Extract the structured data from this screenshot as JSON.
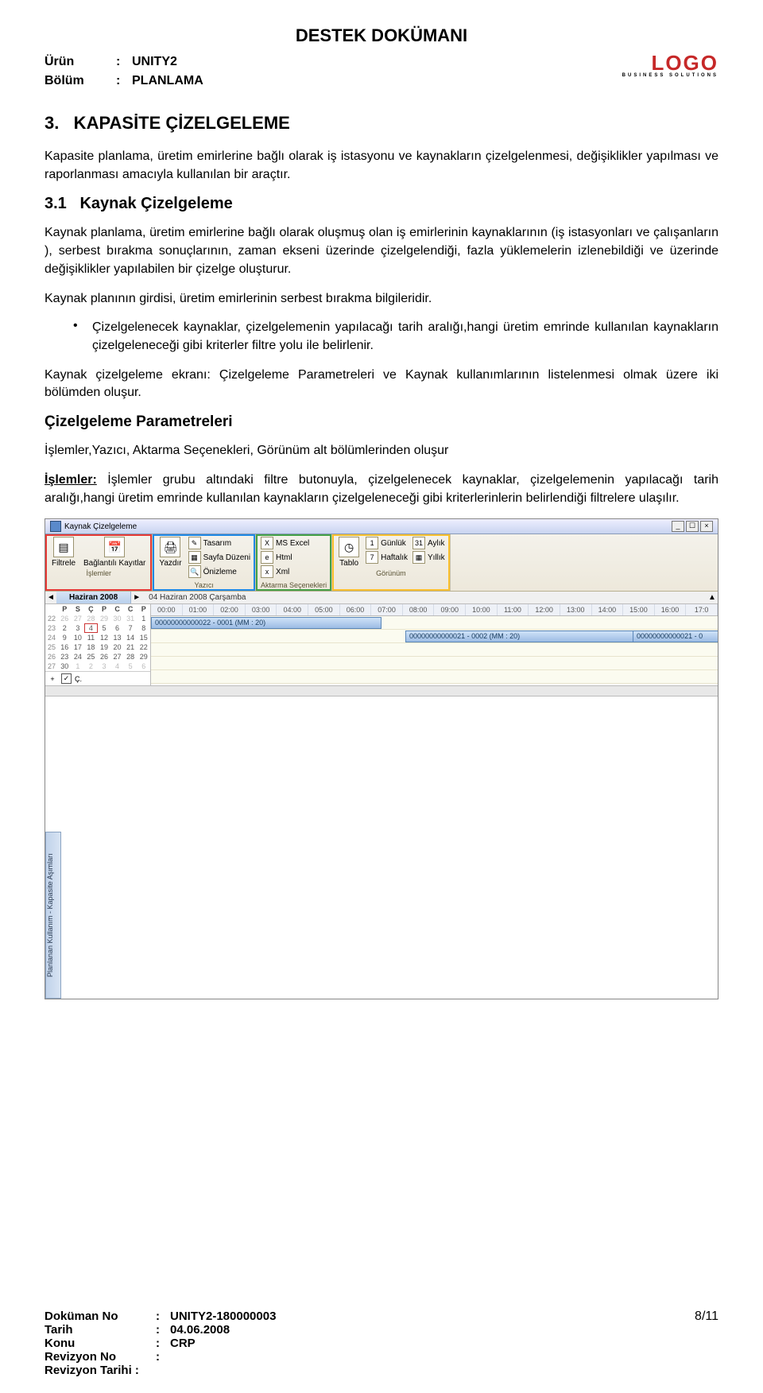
{
  "doc_title": "DESTEK DOKÜMANI",
  "header": {
    "urun_label": "Ürün",
    "bolum_label": "Bölüm",
    "urun_value": "UNITY2",
    "bolum_value": "PLANLAMA"
  },
  "logo": {
    "main": "LOGO",
    "sub": "BUSINESS SOLUTIONS"
  },
  "section": {
    "num_title": "3.   KAPASİTE ÇİZELGELEME",
    "para1": "Kapasite planlama, üretim emirlerine bağlı olarak iş istasyonu ve kaynakların çizelgelenmesi, değişiklikler yapılması ve raporlanması amacıyla kullanılan bir araçtır."
  },
  "subsection": {
    "num_title": "3.1   Kaynak Çizelgeleme",
    "para2": "Kaynak planlama, üretim emirlerine bağlı olarak oluşmuş olan iş emirlerinin kaynaklarının (iş istasyonları ve çalışanların ), serbest bırakma sonuçlarının, zaman ekseni üzerinde çizelgelendiği, fazla yüklemelerin izlenebildiği ve üzerinde değişiklikler yapılabilen bir çizelge oluşturur.",
    "para3": "Kaynak planının girdisi, üretim emirlerinin serbest bırakma bilgileridir.",
    "bullet1": "Çizelgelenecek kaynaklar, çizelgelemenin yapılacağı tarih aralığı,hangi üretim emrinde kullanılan kaynakların çizelgeleneceği gibi kriterler filtre yolu ile belirlenir.",
    "para4": "Kaynak çizelgeleme ekranı: Çizelgeleme Parametreleri ve Kaynak kullanımlarının listelenmesi olmak üzere iki bölümden oluşur.",
    "subhead": "Çizelgeleme Parametreleri",
    "para5": "İşlemler,Yazıcı, Aktarma Seçenekleri, Görünüm alt bölümlerinden oluşur",
    "islemler_label": "İşlemler:",
    "para6_rest": " İşlemler grubu altındaki filtre butonuyla, çizelgelenecek kaynaklar, çizelgelemenin yapılacağı tarih aralığı,hangi üretim emrinde kullanılan kaynakların çizelgeleneceği gibi kriterlerinlerin belirlendiği filtrelere ulaşılır."
  },
  "screenshot": {
    "title": "Kaynak Çizelgeleme",
    "ribbon": {
      "islemler": {
        "filtrele": "Filtrele",
        "baglantili": "Bağlantılı Kayıtlar",
        "label": "İşlemler"
      },
      "yazici": {
        "yazdir": "Yazdır",
        "tasarim": "Tasarım",
        "sayfa": "Sayfa Düzeni",
        "onizleme": "Önizleme",
        "label": "Yazıcı"
      },
      "aktarma": {
        "excel": "MS Excel",
        "html": "Html",
        "xml": "Xml",
        "label": "Aktarma Seçenekleri"
      },
      "gorunum": {
        "tablo": "Tablo",
        "gunluk": "Günlük",
        "aylik": "Aylık",
        "haftalik": "Haftalık",
        "yillik": "Yıllık",
        "g1": "1",
        "g31": "31",
        "g7": "7",
        "label": "Görünüm"
      }
    },
    "nav": {
      "month": "Haziran 2008",
      "day": "04 Haziran 2008 Çarşamba"
    },
    "calendar": {
      "headers": [
        "",
        "P",
        "S",
        "Ç",
        "P",
        "C",
        "C",
        "P"
      ],
      "rows": [
        [
          "22",
          "26",
          "27",
          "28",
          "29",
          "30",
          "31",
          "1"
        ],
        [
          "23",
          "2",
          "3",
          "4",
          "5",
          "6",
          "7",
          "8"
        ],
        [
          "24",
          "9",
          "10",
          "11",
          "12",
          "13",
          "14",
          "15"
        ],
        [
          "25",
          "16",
          "17",
          "18",
          "19",
          "20",
          "21",
          "22"
        ],
        [
          "26",
          "23",
          "24",
          "25",
          "26",
          "27",
          "28",
          "29"
        ],
        [
          "27",
          "30",
          "1",
          "2",
          "3",
          "4",
          "5",
          "6"
        ]
      ],
      "footer_label": "Ç."
    },
    "timeline": {
      "hours": [
        "00:00",
        "01:00",
        "02:00",
        "03:00",
        "04:00",
        "05:00",
        "06:00",
        "07:00",
        "08:00",
        "09:00",
        "10:00",
        "11:00",
        "12:00",
        "13:00",
        "14:00",
        "15:00",
        "16:00",
        "17:0"
      ],
      "bar1": "00000000000022 - 0001 (MM : 20)",
      "bar2": "00000000000021 - 0002 (MM : 20)",
      "bar3": "00000000000021 - 0"
    },
    "side_tab": "Planlanan Kullanım - Kapasite Aşımları"
  },
  "footer": {
    "dokuman_no_label": "Doküman No",
    "dokuman_no": "UNITY2-180000003",
    "tarih_label": "Tarih",
    "tarih": "04.06.2008",
    "konu_label": "Konu",
    "konu": "CRP",
    "revno_label": "Revizyon No",
    "revtarih_label": "Revizyon Tarihi :",
    "page": "8/11"
  }
}
